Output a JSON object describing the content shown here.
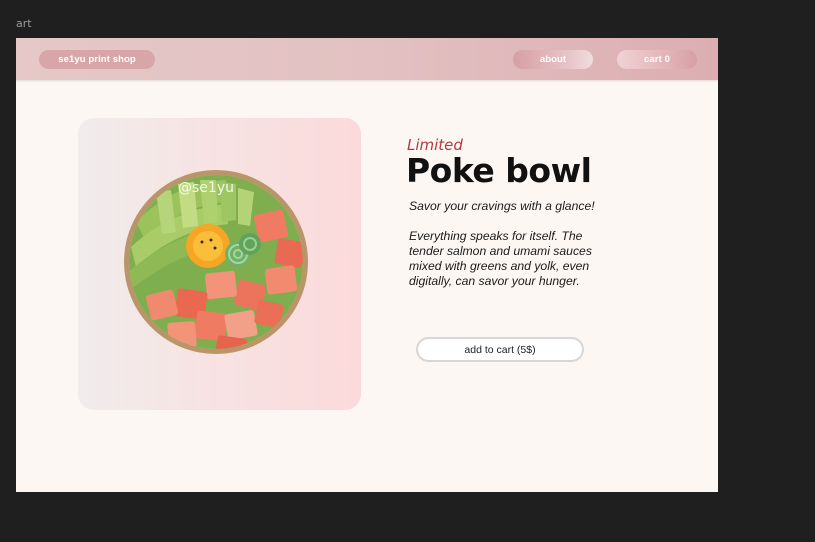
{
  "frame": {
    "label": "art"
  },
  "nav": {
    "brand": "se1yu print shop",
    "about": "about",
    "cart": "cart 0"
  },
  "product": {
    "eyebrow": "Limited",
    "title": "Poke bowl",
    "tagline": "Savor your cravings with a glance!",
    "description": "Everything speaks for itself. The tender salmon and umami sauces mixed with greens and yolk, even digitally, can savor your hunger.",
    "image_watermark": "@se1yu",
    "add_to_cart": "add to cart (5$)"
  },
  "colors": {
    "navbar": "#e3c1c2",
    "accent_red": "#b43a3f",
    "page_bg": "#fdf7f4"
  }
}
